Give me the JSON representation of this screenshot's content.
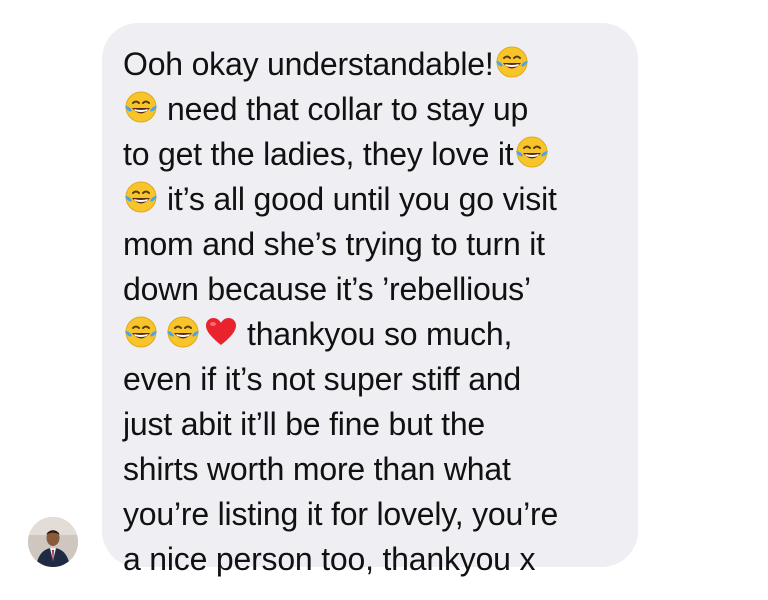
{
  "conversation": {
    "avatar_alt": "Sender profile photo",
    "message_lines": [
      "Ooh okay understandable!",
      "need that collar to stay up",
      "to get the ladies, they love it",
      "it’s all good until you go visit",
      "mom and she’s trying to turn it",
      "down because it’s ’rebellious’",
      "thankyou so much,",
      "even if it’s not super stiff and",
      "just abit it’ll be fine but the",
      "shirts worth more than what",
      "you’re listing it for lovely, you’re",
      "a nice person too, thankyou x"
    ],
    "emojis": {
      "laugh": "face-with-tears-of-joy-icon",
      "heart": "red-heart-icon"
    }
  },
  "colors": {
    "bubble_background": "#eeeef3",
    "text": "#111111",
    "emoji_face": "#f7c52a",
    "emoji_tears": "#4aa3ef",
    "heart": "#e8232e"
  }
}
